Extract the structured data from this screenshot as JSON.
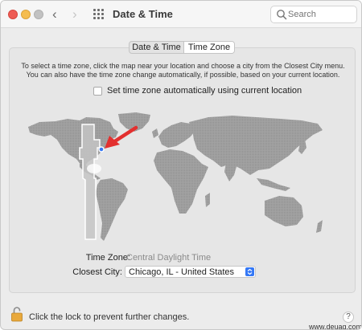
{
  "window": {
    "title": "Date & Time",
    "search_placeholder": "Search"
  },
  "tabs": [
    {
      "label": "Date & Time",
      "selected": false
    },
    {
      "label": "Time Zone",
      "selected": true
    }
  ],
  "panel": {
    "intro_line1": "To select a time zone, click the map near your location and choose a city from the Closest City menu.",
    "intro_line2": "You can also have the time zone change automatically, if possible, based on your current location.",
    "auto_checkbox": {
      "label": "Set time zone automatically using current location",
      "checked": false
    },
    "time_zone_label": "Time Zone:",
    "time_zone_value": "Central Daylight Time",
    "closest_city_label": "Closest City:",
    "closest_city_value": "Chicago, IL - United States"
  },
  "footer": {
    "lock_text": "Click the lock to prevent further changes.",
    "help_label": "?"
  },
  "watermark": "www.deuaq.com",
  "colors": {
    "accent": "#3478f6",
    "arrow": "#e3302f",
    "land": "#9c9c9c",
    "selected_zone": "#b9b9b9"
  },
  "icons": [
    "grid-icon",
    "search-icon",
    "lock-icon",
    "chevron-updown-icon",
    "arrow-annotation"
  ]
}
